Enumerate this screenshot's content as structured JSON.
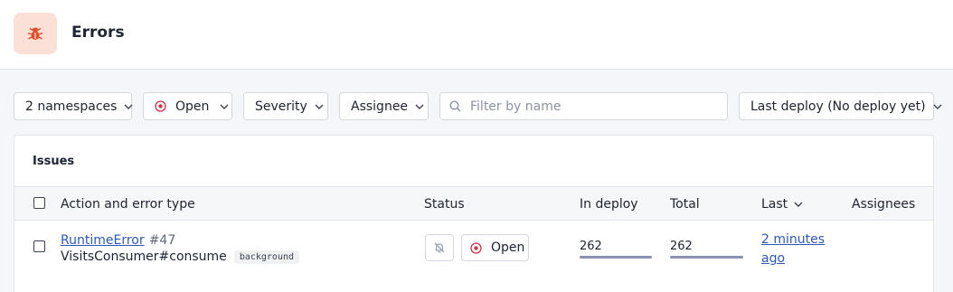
{
  "app": {
    "title": "Errors",
    "icon": "bug-icon",
    "icon_color": "#e0502e",
    "icon_bg": "#fbe0d8"
  },
  "filters": {
    "namespaces": "2 namespaces",
    "status": "Open",
    "severity": "Severity",
    "assignee": "Assignee",
    "search_placeholder": "Filter by name",
    "deploy": "Last deploy (No deploy yet)"
  },
  "issues": {
    "title": "Issues",
    "columns": {
      "action": "Action and error type",
      "status": "Status",
      "in_deploy": "In deploy",
      "total": "Total",
      "last": "Last",
      "assignees": "Assignees"
    },
    "rows": [
      {
        "error_type": "RuntimeError",
        "number": "#47",
        "action": "VisitsConsumer#consume",
        "tag": "background",
        "status": "Open",
        "in_deploy": "262",
        "in_deploy_fill": 1.0,
        "total": "262",
        "total_fill": 1.0,
        "last": "2 minutes ago",
        "assignees": ""
      }
    ]
  },
  "colors": {
    "accent_link": "#2e58b8",
    "open_status": "#d2334b",
    "bar_fill": "#8a93b5"
  }
}
